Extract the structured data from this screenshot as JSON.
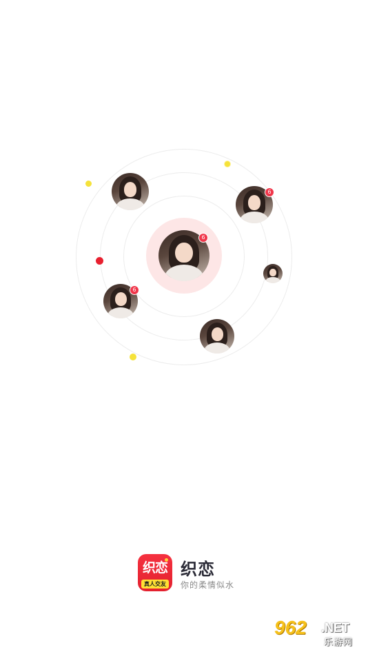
{
  "orbit": {
    "avatars": [
      {
        "id": "center",
        "badge": "6"
      },
      {
        "id": "top-left",
        "badge": ""
      },
      {
        "id": "top-right",
        "badge": "6"
      },
      {
        "id": "right-small",
        "badge": ""
      },
      {
        "id": "left-lower",
        "badge": "6"
      },
      {
        "id": "bottom",
        "badge": ""
      }
    ],
    "colors": {
      "ring": "#ececec",
      "halo": "#fde6e6",
      "badge": "#f0364a",
      "dot_yellow": "#f5e23a",
      "dot_red": "#e8202f"
    }
  },
  "brand": {
    "logo_main": "织恋",
    "logo_sub": "真人交友",
    "app_name": "织恋",
    "slogan": "你的柔情似水",
    "logo_color": "#e8202f"
  },
  "watermark": {
    "number": "962",
    "suffix": ".NET",
    "cn": "乐游网"
  }
}
